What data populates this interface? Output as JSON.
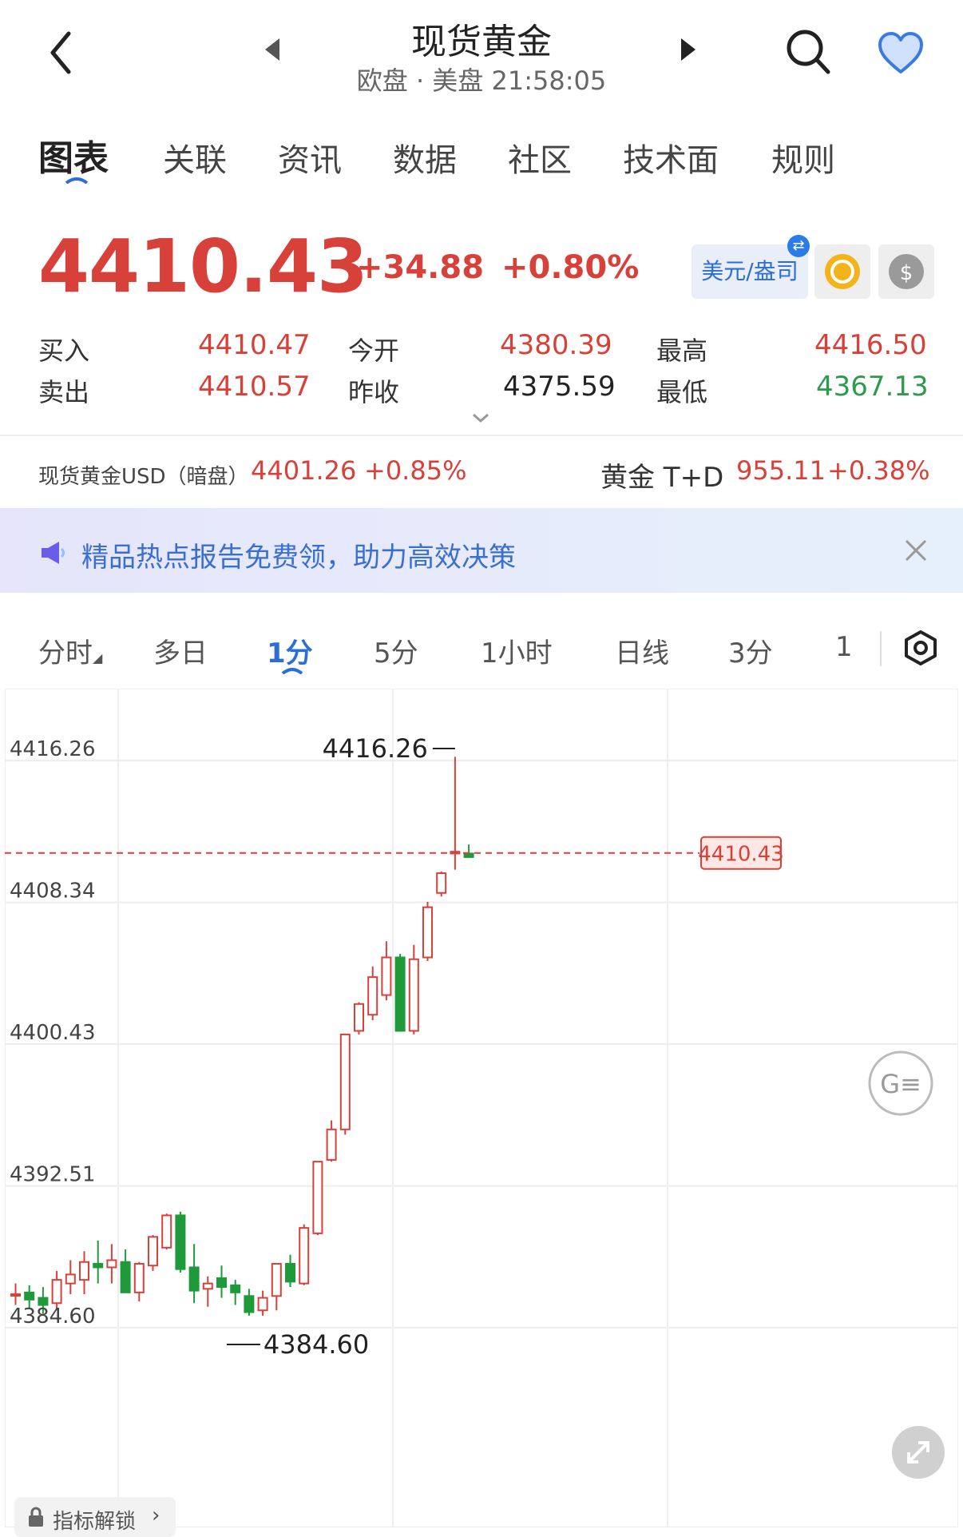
{
  "header": {
    "title": "现货黄金",
    "subtitle": "欧盘 · 美盘 21:58:05"
  },
  "tabs": [
    {
      "label": "图表"
    },
    {
      "label": "关联"
    },
    {
      "label": "资讯"
    },
    {
      "label": "数据"
    },
    {
      "label": "社区"
    },
    {
      "label": "技术面"
    },
    {
      "label": "规则"
    }
  ],
  "quote": {
    "price": "4410.43",
    "change": "+34.88",
    "change_pct": "+0.80%",
    "unit_label": "美元/盎司",
    "buy_label": "买入",
    "buy": "4410.47",
    "sell_label": "卖出",
    "sell": "4410.57",
    "open_label": "今开",
    "open": "4380.39",
    "prev_close_label": "昨收",
    "prev_close": "4375.59",
    "high_label": "最高",
    "high": "4416.50",
    "low_label": "最低",
    "low": "4367.13"
  },
  "ticker": {
    "left_label": "现货黄金USD（暗盘）",
    "left_value": "4401.26",
    "left_change": "+0.85%",
    "right_label": "黄金 T+D",
    "right_value": "955.11",
    "right_change": "+0.38%"
  },
  "banner": {
    "text": "精品热点报告免费领，助力高效决策"
  },
  "period_tabs": [
    {
      "label": "分时"
    },
    {
      "label": "多日"
    },
    {
      "label": "1分"
    },
    {
      "label": "5分"
    },
    {
      "label": "1小时"
    },
    {
      "label": "日线"
    },
    {
      "label": "3分"
    },
    {
      "label": "1"
    }
  ],
  "unlock_label": "指标解锁",
  "colors": {
    "up": "#d8403a",
    "down": "#1f9a3a",
    "accent": "#2b6fd6"
  },
  "chart_data": {
    "type": "candlestick",
    "y_ticks": [
      "4416.26",
      "4408.34",
      "4400.43",
      "4392.51",
      "4384.60"
    ],
    "ylim": [
      4384.6,
      4416.26
    ],
    "max_label": "4416.26",
    "min_label": "4384.60",
    "last_price_label": "4410.43",
    "last_price": 4410.43,
    "candles": [
      {
        "o": 4385.8,
        "h": 4386.4,
        "l": 4385.2,
        "c": 4385.8
      },
      {
        "o": 4385.9,
        "h": 4386.3,
        "l": 4385.0,
        "c": 4385.5
      },
      {
        "o": 4385.6,
        "h": 4386.2,
        "l": 4384.7,
        "c": 4385.2
      },
      {
        "o": 4385.3,
        "h": 4387.1,
        "l": 4384.9,
        "c": 4386.6
      },
      {
        "o": 4386.4,
        "h": 4387.7,
        "l": 4385.8,
        "c": 4386.9
      },
      {
        "o": 4386.6,
        "h": 4388.2,
        "l": 4385.8,
        "c": 4387.6
      },
      {
        "o": 4387.5,
        "h": 4388.8,
        "l": 4386.4,
        "c": 4387.3
      },
      {
        "o": 4387.3,
        "h": 4388.6,
        "l": 4386.4,
        "c": 4387.7
      },
      {
        "o": 4387.6,
        "h": 4388.3,
        "l": 4385.9,
        "c": 4385.9
      },
      {
        "o": 4385.9,
        "h": 4387.6,
        "l": 4385.4,
        "c": 4387.5
      },
      {
        "o": 4387.4,
        "h": 4389.1,
        "l": 4387.1,
        "c": 4389.0
      },
      {
        "o": 4388.4,
        "h": 4390.3,
        "l": 4388.3,
        "c": 4390.2
      },
      {
        "o": 4390.2,
        "h": 4390.4,
        "l": 4387.0,
        "c": 4387.2
      },
      {
        "o": 4387.3,
        "h": 4388.6,
        "l": 4385.3,
        "c": 4386.0
      },
      {
        "o": 4386.1,
        "h": 4386.8,
        "l": 4385.1,
        "c": 4386.4
      },
      {
        "o": 4386.7,
        "h": 4387.4,
        "l": 4385.6,
        "c": 4386.2
      },
      {
        "o": 4386.3,
        "h": 4386.6,
        "l": 4385.2,
        "c": 4385.9
      },
      {
        "o": 4385.7,
        "h": 4386.1,
        "l": 4384.6,
        "c": 4384.8
      },
      {
        "o": 4384.9,
        "h": 4386.0,
        "l": 4384.6,
        "c": 4385.6
      },
      {
        "o": 4385.7,
        "h": 4387.3,
        "l": 4384.9,
        "c": 4387.5
      },
      {
        "o": 4387.5,
        "h": 4388.0,
        "l": 4386.2,
        "c": 4386.5
      },
      {
        "o": 4386.4,
        "h": 4389.7,
        "l": 4386.3,
        "c": 4389.5
      },
      {
        "o": 4389.2,
        "h": 4393.2,
        "l": 4389.1,
        "c": 4393.2
      },
      {
        "o": 4393.3,
        "h": 4395.5,
        "l": 4393.2,
        "c": 4395.0
      },
      {
        "o": 4395.0,
        "h": 4399.7,
        "l": 4394.7,
        "c": 4400.3
      },
      {
        "o": 4400.5,
        "h": 4402.1,
        "l": 4400.3,
        "c": 4402.0
      },
      {
        "o": 4401.4,
        "h": 4404.1,
        "l": 4401.1,
        "c": 4403.5
      },
      {
        "o": 4402.5,
        "h": 4405.5,
        "l": 4402.2,
        "c": 4404.6
      },
      {
        "o": 4404.6,
        "h": 4404.8,
        "l": 4401.1,
        "c": 4400.5
      },
      {
        "o": 4400.5,
        "h": 4405.3,
        "l": 4400.3,
        "c": 4404.5
      },
      {
        "o": 4404.6,
        "h": 4407.7,
        "l": 4404.4,
        "c": 4407.4
      },
      {
        "o": 4408.2,
        "h": 4409.4,
        "l": 4408.0,
        "c": 4409.3
      },
      {
        "o": 4410.4,
        "h": 4415.8,
        "l": 4409.5,
        "c": 4410.5
      },
      {
        "o": 4410.4,
        "h": 4410.9,
        "l": 4410.2,
        "c": 4410.2
      }
    ]
  }
}
